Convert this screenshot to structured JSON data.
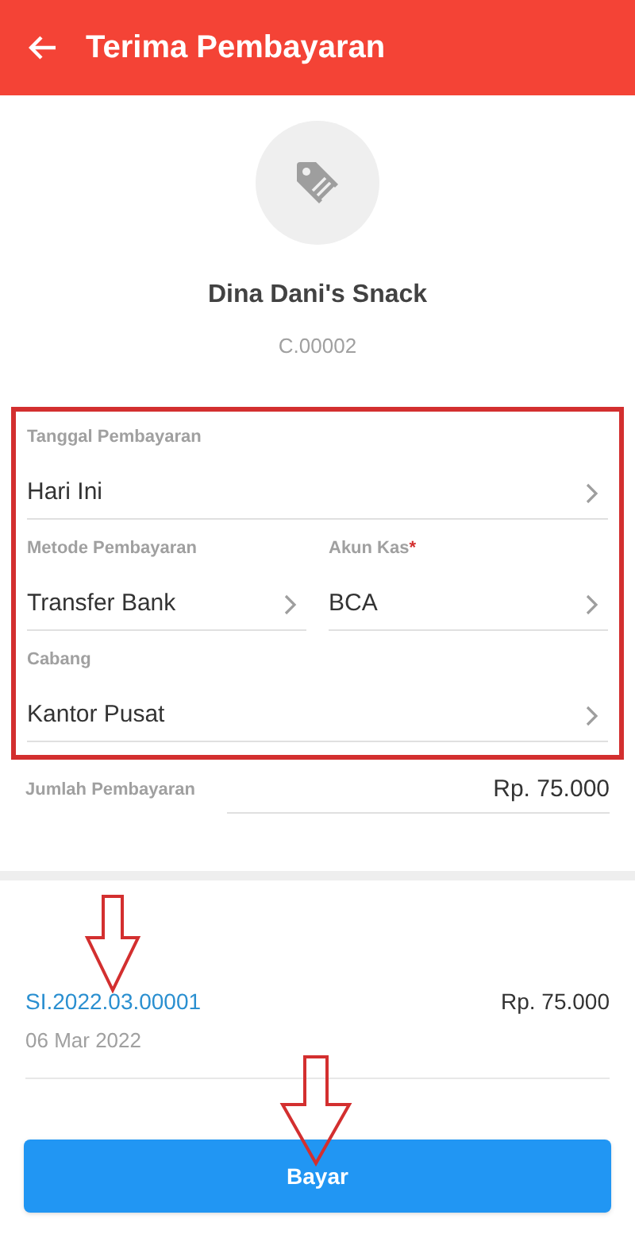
{
  "app_bar": {
    "title": "Terima Pembayaran"
  },
  "customer": {
    "name": "Dina Dani's Snack",
    "code": "C.00002"
  },
  "form_rows": [
    [
      {
        "label": "Tanggal Pembayaran",
        "value": "Hari Ini"
      }
    ],
    [
      {
        "label": "Metode Pembayaran",
        "value": "Transfer Bank"
      },
      {
        "label": "Akun Kas",
        "required_mark": "*",
        "value": "BCA"
      }
    ],
    [
      {
        "label": "Cabang",
        "value": "Kantor Pusat"
      }
    ]
  ],
  "payment_amount": {
    "label": "Jumlah Pembayaran",
    "value": "Rp. 75.000"
  },
  "invoices": [
    {
      "number": "SI.2022.03.00001",
      "date": "06 Mar 2022",
      "amount": "Rp. 75.000"
    }
  ],
  "primary_button": "Bayar"
}
